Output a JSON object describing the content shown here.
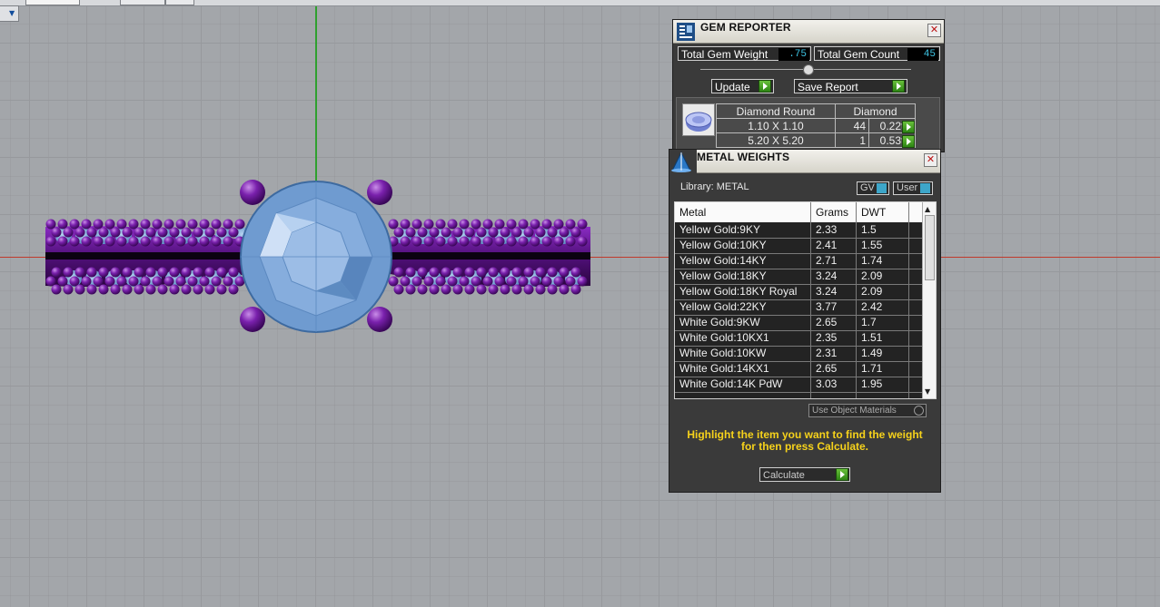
{
  "gem_reporter": {
    "title": "GEM REPORTER",
    "total_weight_label": "Total Gem Weight",
    "total_weight_value": ".75",
    "total_count_label": "Total Gem Count",
    "total_count_value": "45",
    "update_label": "Update",
    "save_report_label": "Save Report",
    "table": {
      "header": [
        "Diamond Round",
        "Diamond"
      ],
      "rows": [
        {
          "size": "1.10 X 1.10",
          "count": "44",
          "weight": "0.22tw"
        },
        {
          "size": "5.20 X 5.20",
          "count": "1",
          "weight": "0.53tw"
        }
      ]
    }
  },
  "metal_weights": {
    "title": "METAL WEIGHTS",
    "library_label": "Library: METAL",
    "gv_label": "GV",
    "user_label": "User",
    "columns": [
      "Metal",
      "Grams",
      "DWT"
    ],
    "rows": [
      {
        "metal": "Yellow Gold:9KY",
        "grams": "2.33",
        "dwt": "1.5"
      },
      {
        "metal": "Yellow Gold:10KY",
        "grams": "2.41",
        "dwt": "1.55"
      },
      {
        "metal": "Yellow Gold:14KY",
        "grams": "2.71",
        "dwt": "1.74"
      },
      {
        "metal": "Yellow Gold:18KY",
        "grams": "3.24",
        "dwt": "2.09"
      },
      {
        "metal": "Yellow Gold:18KY Royal",
        "grams": "3.24",
        "dwt": "2.09"
      },
      {
        "metal": "Yellow Gold:22KY",
        "grams": "3.77",
        "dwt": "2.42"
      },
      {
        "metal": "White Gold:9KW",
        "grams": "2.65",
        "dwt": "1.7"
      },
      {
        "metal": "White Gold:10KX1",
        "grams": "2.35",
        "dwt": "1.51"
      },
      {
        "metal": "White Gold:10KW",
        "grams": "2.31",
        "dwt": "1.49"
      },
      {
        "metal": "White Gold:14KX1",
        "grams": "2.65",
        "dwt": "1.71"
      },
      {
        "metal": "White Gold:14K PdW",
        "grams": "3.03",
        "dwt": "1.95"
      }
    ],
    "use_object_materials_label": "Use Object Materials",
    "instruction": "Highlight the item you want to find the weight for then press Calculate.",
    "calculate_label": "Calculate"
  },
  "colors": {
    "viewport_bg": "#a3a6aa",
    "panel_bg": "#3a3a3a",
    "accent_green": "#3c9b1d",
    "gem_blue": "#7fa8dc",
    "metal_purple": "#6b1a9a",
    "instruction_yellow": "#f6d21b",
    "value_cyan": "#3ec6e6"
  }
}
